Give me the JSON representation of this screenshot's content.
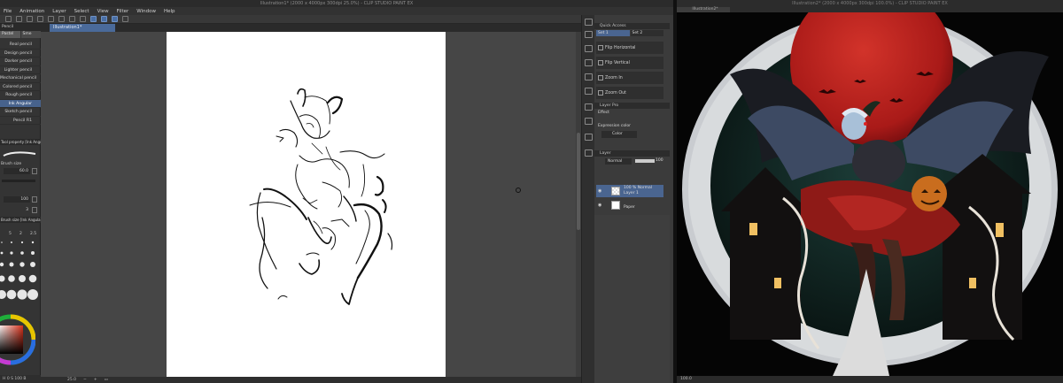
{
  "left_app": {
    "window_title": "Illustration1* (2000 x 4000px 300dpi 25.0%) - CLIP STUDIO PAINT EX",
    "menu": [
      "File",
      "Animation",
      "Layer",
      "Select",
      "View",
      "Filter",
      "Window",
      "Help"
    ],
    "doc_tab": "Illustration1*",
    "subtool_tabs": [
      "Pastel",
      "Sme"
    ],
    "brushes": [
      "Real pencil",
      "Design pencil",
      "Darker pencil",
      "Lighter pencil",
      "Mechanical pencil",
      "Colored pencil",
      "Rough pencil",
      "Ink Angular",
      "Sketch pencil",
      "Pencil R1"
    ],
    "selected_brush": "Ink Angular",
    "tool_property_title": "Tool property [Ink Angular]",
    "brush_size_label": "Brush size",
    "brush_size_value": "60.0",
    "opacity_value": "100",
    "stabilization_value": "3",
    "brush_size_panel_title": "Brush size [Ink Angular]",
    "size_grid": [
      "5",
      "2",
      "2.5"
    ],
    "zoom_status": "25.0",
    "quick_access": {
      "title": "Quick Access",
      "sets": [
        "Set 1",
        "Set 2"
      ],
      "items": [
        "Flip Horizontal",
        "Flip Vertical",
        "Zoom In",
        "Zoom Out"
      ]
    },
    "layer_property": {
      "title": "Layer Pro",
      "effect_label": "Effect",
      "expression_label": "Expression color",
      "color_value": "Color"
    },
    "layer_panel": {
      "title": "Layer",
      "blend": "Normal",
      "opacity": "100",
      "layers": [
        {
          "line1": "100 % Normal",
          "line2": "Layer 1",
          "selected": true
        },
        {
          "line1": "",
          "line2": "Paper",
          "selected": false
        }
      ]
    }
  },
  "right_app": {
    "window_title": "Illustration2* (2000 x 4000px 300dpi 100.0%) - CLIP STUDIO PAINT EX",
    "doc_tab": "Illustration2*",
    "zoom_status": "100.0"
  },
  "colors": {
    "accent": "#4a6a9a",
    "moon": "#b0201c",
    "sky": "#0f2a28"
  }
}
